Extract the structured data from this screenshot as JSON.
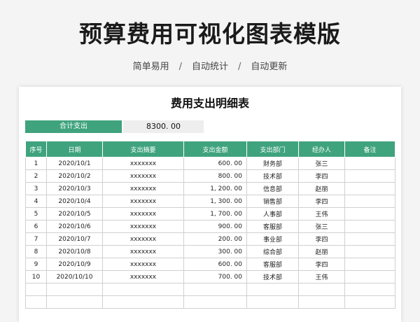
{
  "header": {
    "title": "预算费用可视化图表模版",
    "subtitle_items": [
      "简单易用",
      "自动统计",
      "自动更新"
    ],
    "separator": "/"
  },
  "sheet": {
    "title": "费用支出明细表",
    "total_label": "合计支出",
    "total_value": "8300. 00",
    "columns": [
      "序号",
      "日期",
      "支出摘要",
      "支出金额",
      "支出部门",
      "经办人",
      "备注"
    ],
    "rows": [
      [
        "1",
        "2020/10/1",
        "xxxxxxx",
        "600. 00",
        "财务部",
        "张三",
        ""
      ],
      [
        "2",
        "2020/10/2",
        "xxxxxxx",
        "800. 00",
        "技术部",
        "李四",
        ""
      ],
      [
        "3",
        "2020/10/3",
        "xxxxxxx",
        "1, 200. 00",
        "信息部",
        "赵丽",
        ""
      ],
      [
        "4",
        "2020/10/4",
        "xxxxxxx",
        "1, 300. 00",
        "销售部",
        "李四",
        ""
      ],
      [
        "5",
        "2020/10/5",
        "xxxxxxx",
        "1, 700. 00",
        "人事部",
        "王伟",
        ""
      ],
      [
        "6",
        "2020/10/6",
        "xxxxxxx",
        "900. 00",
        "客服部",
        "张三",
        ""
      ],
      [
        "7",
        "2020/10/7",
        "xxxxxxx",
        "200. 00",
        "事业部",
        "李四",
        ""
      ],
      [
        "8",
        "2020/10/8",
        "xxxxxxx",
        "300. 00",
        "综合部",
        "赵丽",
        ""
      ],
      [
        "9",
        "2020/10/9",
        "xxxxxxx",
        "600. 00",
        "客服部",
        "李四",
        ""
      ],
      [
        "10",
        "2020/10/10",
        "xxxxxxx",
        "700. 00",
        "技术部",
        "王伟",
        ""
      ],
      [
        "",
        "",
        "",
        "",
        "",
        "",
        ""
      ],
      [
        "",
        "",
        "",
        "",
        "",
        "",
        ""
      ]
    ]
  }
}
